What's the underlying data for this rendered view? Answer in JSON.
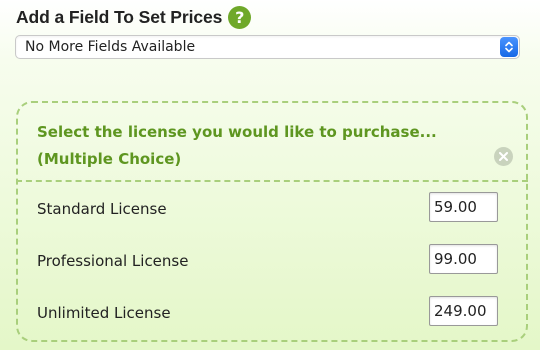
{
  "header": {
    "title": "Add a Field To Set Prices",
    "help_icon": "question-mark-icon",
    "help_glyph": "?"
  },
  "field_select": {
    "selected_value": "No More Fields Available",
    "icon": "up-down-arrows-icon"
  },
  "price_group": {
    "title": "Select the license you would like to purchase... (Multiple Choice)",
    "remove_icon": "close-circle-icon",
    "rows": [
      {
        "label": "Standard License",
        "price": "59.00"
      },
      {
        "label": "Professional License",
        "price": "99.00"
      },
      {
        "label": "Unlimited License",
        "price": "249.00"
      }
    ]
  },
  "colors": {
    "accent_green": "#6fa82a",
    "title_green": "#5e9620",
    "dashed_border": "#a9cf7c",
    "select_arrow_blue": "#1768e6"
  }
}
